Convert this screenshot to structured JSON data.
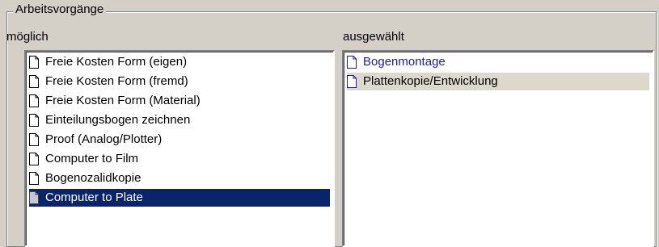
{
  "group": {
    "title": "Arbeitsvorgänge"
  },
  "available": {
    "label": "möglich",
    "items": [
      "Freie Kosten Form (eigen)",
      "Freie Kosten Form (fremd)",
      "Freie Kosten Form (Material)",
      "Einteilungsbogen zeichnen",
      "Proof (Analog/Plotter)",
      "Computer to Film",
      "Bogenozalidkopie",
      "Computer to Plate"
    ],
    "selected_item": "Computer to Plate"
  },
  "chosen": {
    "label": "ausgewählt",
    "items": [
      "Bogenmontage",
      "Plattenkopie/Entwicklung"
    ]
  },
  "icons": {
    "list_item_icon": "document-icon"
  },
  "colors": {
    "selection_bg": "#0a246a",
    "selection_text": "#ffffff",
    "window_bg": "#d4d0c8",
    "list_bg": "#ffffff",
    "highlight_text": "#1a1ab0",
    "hover_bg": "#dcd8cc"
  }
}
